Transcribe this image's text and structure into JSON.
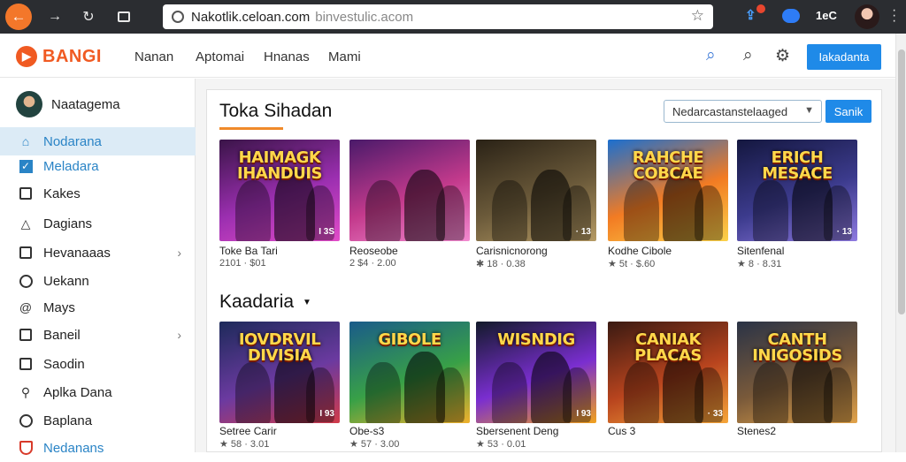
{
  "browser": {
    "url_host": "Nakotlik.celoan.com",
    "url_rest": "binvestulic.acom",
    "ext_label": "1eC"
  },
  "header": {
    "logo_text": "BANGI",
    "nav": [
      "Nanan",
      "Aptomai",
      "Hnanas",
      "Mami"
    ],
    "cta_label": "Iakadanta"
  },
  "sidebar": {
    "user_name": "Naatagema",
    "items": [
      {
        "label": "Nodarana",
        "icon": "home-icon",
        "state": "active"
      },
      {
        "label": "Meladara",
        "icon": "checkbox-icon",
        "state": "checked"
      },
      {
        "label": "Kakes",
        "icon": "box-icon"
      },
      {
        "label": "Dagians",
        "icon": "warning-icon"
      },
      {
        "label": "Hevanaaas",
        "icon": "collection-icon",
        "chevron": true
      },
      {
        "label": "Uekann",
        "icon": "circle-icon"
      },
      {
        "label": "Mays",
        "icon": "at-icon"
      },
      {
        "label": "Baneil",
        "icon": "tablet-icon",
        "chevron": true
      },
      {
        "label": "Saodin",
        "icon": "card-icon"
      },
      {
        "label": "Aplka Dana",
        "icon": "store-icon"
      },
      {
        "label": "Baplana",
        "icon": "circle-icon"
      },
      {
        "label": "Nedanans",
        "icon": "shield-icon",
        "state": "checked"
      }
    ]
  },
  "main": {
    "section1_title": "Toka Sihadan",
    "sort_value": "Nedarcastanstelaaged",
    "go_label": "Sanik",
    "section2_title": "Kaadaria",
    "row1": [
      {
        "title_art": "HAIMAGK\nIHANDUIS",
        "tag": "I 3S",
        "name": "Toke Ba Tari",
        "meta": "2101 · $01",
        "palette": [
          "#3a1448",
          "#9b2fb0",
          "#e24cc9"
        ]
      },
      {
        "title_art": "",
        "tag": "",
        "name": "Reoseobe",
        "meta": "2 $4 · 2.00",
        "palette": [
          "#4a1a6a",
          "#c33a8c",
          "#f28ad0"
        ]
      },
      {
        "title_art": "",
        "tag": "· 13",
        "name": "Carisnicnorong",
        "meta": "✱ 18 · 0.38",
        "palette": [
          "#2a2216",
          "#6b5a3a",
          "#b59a64"
        ]
      },
      {
        "title_art": "RAHCHE\nCOBCAE",
        "tag": "",
        "name": "Kodhe Cibole",
        "meta": "★ 5t · $.60",
        "palette": [
          "#1b6fd0",
          "#f27b23",
          "#fbd24a"
        ]
      },
      {
        "title_art": "ERICH\nMESACE",
        "tag": "· 13",
        "name": "Sitenfenal",
        "meta": "★ 8 · 8.31",
        "palette": [
          "#14173f",
          "#3c3b8d",
          "#8e7ae0"
        ]
      }
    ],
    "row2": [
      {
        "title_art": "IOVDRVIL\nDIVISIA",
        "tag": "I 93",
        "name": "Setree Carir",
        "meta": "★ 58 · 3.01",
        "palette": [
          "#1d2a5a",
          "#6b3aa0",
          "#d23b4a"
        ]
      },
      {
        "title_art": "GIBOLE",
        "tag": "",
        "name": "Obe-s3",
        "meta": "★ 57 · 3.00",
        "palette": [
          "#1a5b8a",
          "#38a047",
          "#f0b12c"
        ]
      },
      {
        "title_art": "WISNDIG",
        "tag": "I 93",
        "name": "Sbersenent Deng",
        "meta": "★ 53 · 0.01",
        "palette": [
          "#121a2a",
          "#7a2ed0",
          "#f2a21c"
        ]
      },
      {
        "title_art": "CANIAK\nPLACAS",
        "tag": "· 33",
        "name": "Cus 3",
        "meta": "",
        "palette": [
          "#3a1a12",
          "#b8441e",
          "#f6a63a"
        ]
      },
      {
        "title_art": "CANTH\nINIGOSIDS",
        "tag": "",
        "name": "Stenes2",
        "meta": "",
        "palette": [
          "#2a3346",
          "#7a5a3a",
          "#e2a34a"
        ]
      }
    ]
  },
  "colors": {
    "accent": "#1f8ae8",
    "brand": "#f05a22",
    "active_bg": "#dcebf6"
  }
}
